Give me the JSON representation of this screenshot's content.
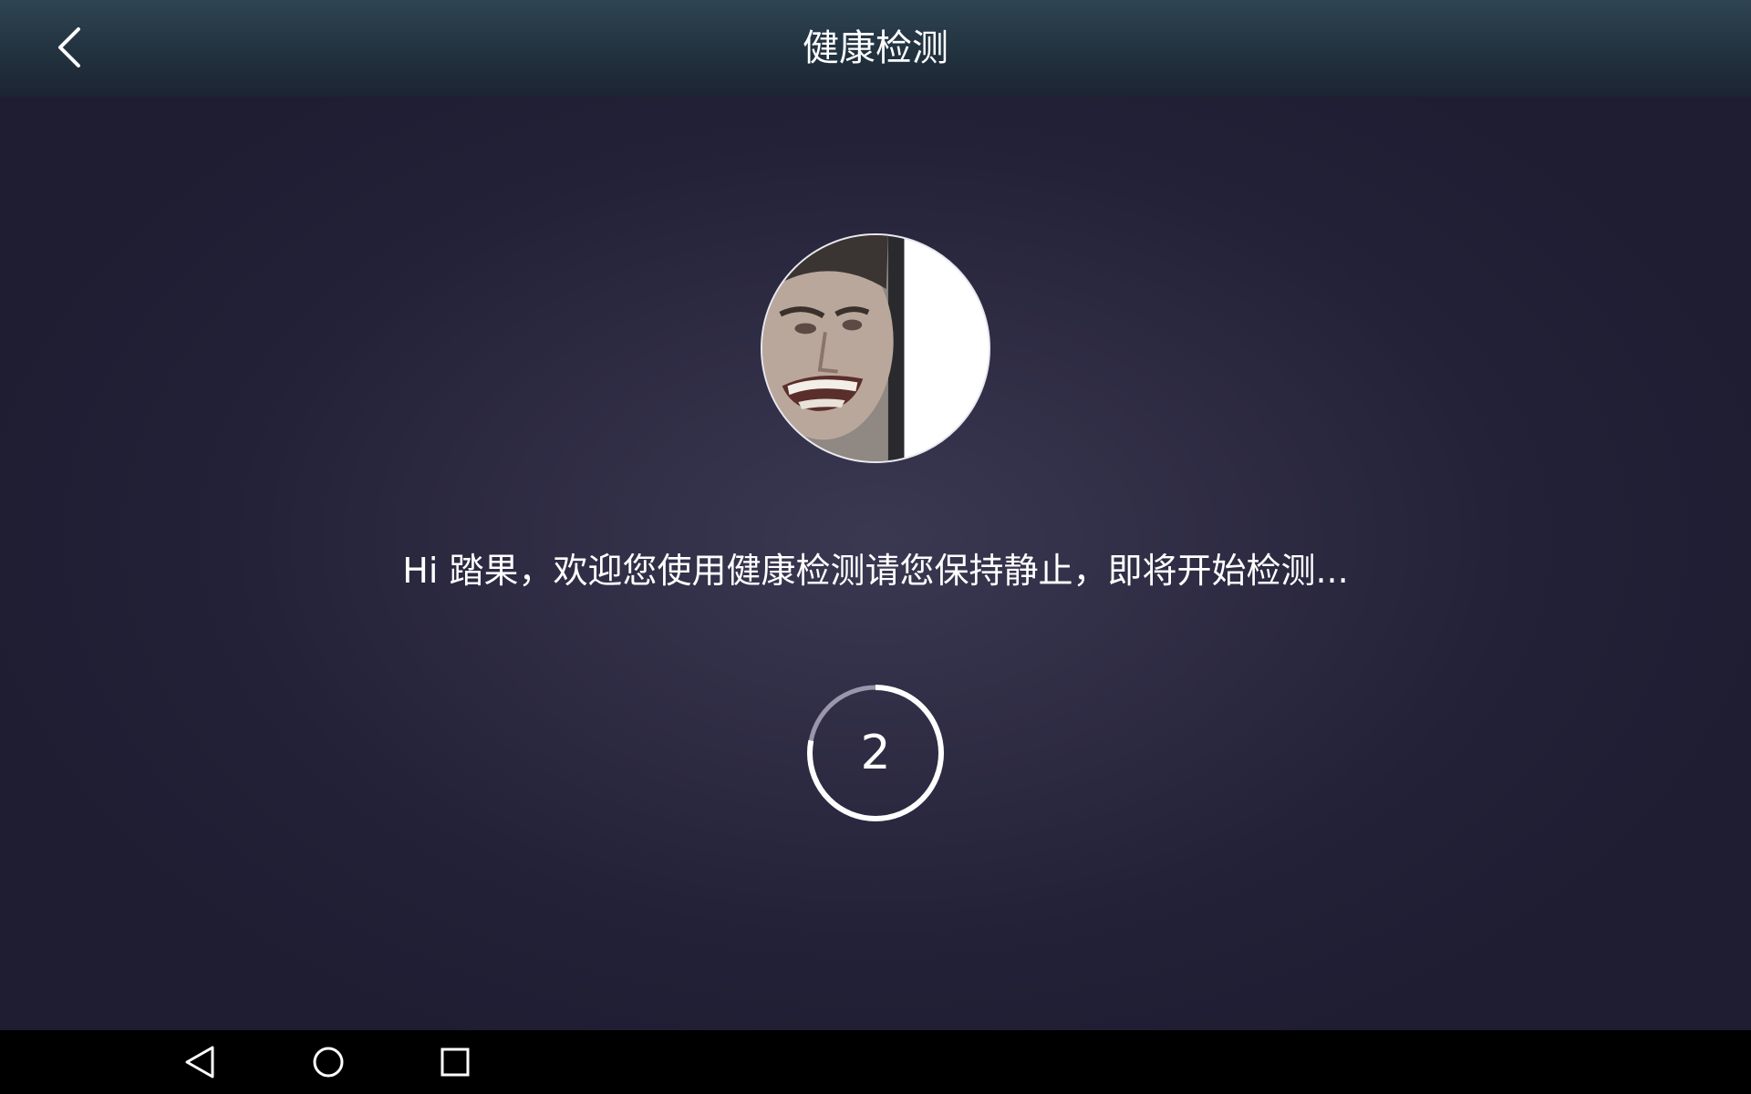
{
  "app": {
    "title": "健康检测"
  },
  "header": {
    "back_icon": "chevron-left-icon"
  },
  "main": {
    "avatar_icon": "user-avatar-photo",
    "welcome_text": "Hi 踏果，欢迎您使用健康检测请您保持静止，即将开始检测...",
    "countdown": {
      "value": "2",
      "progress": 0.78
    }
  },
  "system_nav": {
    "back_icon": "triangle-back-icon",
    "home_icon": "circle-home-icon",
    "recents_icon": "square-recents-icon"
  },
  "colors": {
    "background": "#1f1d32",
    "header": "#22323f",
    "text": "#ffffff",
    "nav_bar": "#000000"
  }
}
